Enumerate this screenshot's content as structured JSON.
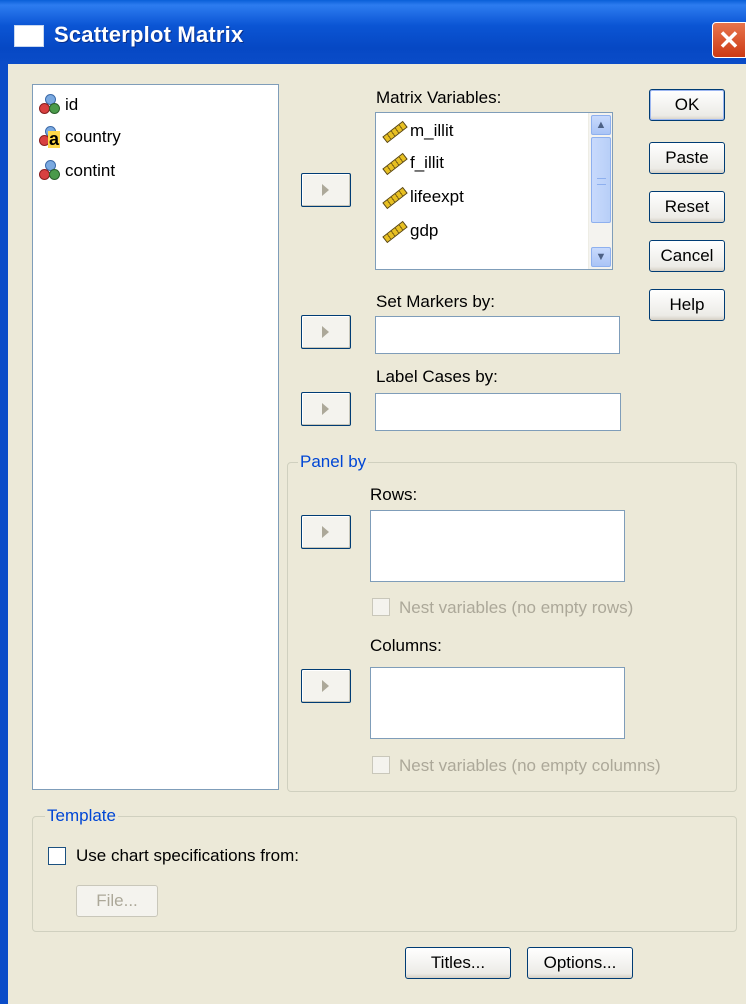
{
  "window": {
    "title": "Scatterplot Matrix",
    "close_glyph": "✕"
  },
  "variables": [
    {
      "name": "id",
      "icon": "nominal-icon"
    },
    {
      "name": "country",
      "icon": "string-nominal-icon",
      "letter": "a"
    },
    {
      "name": "contint",
      "icon": "nominal-icon"
    }
  ],
  "matrix": {
    "label": "Matrix Variables:",
    "items": [
      "m_illit",
      "f_illit",
      "lifeexpt",
      "gdp"
    ]
  },
  "markers": {
    "label": "Set Markers by:",
    "value": ""
  },
  "label_cases": {
    "label": "Label Cases by:",
    "value": ""
  },
  "panel": {
    "title": "Panel by",
    "rows_label": "Rows:",
    "nest_rows_label": "Nest variables (no empty rows)",
    "columns_label": "Columns:",
    "nest_columns_label": "Nest variables (no empty columns)"
  },
  "template": {
    "title": "Template",
    "use_spec_label": "Use chart specifications from:",
    "file_button": "File..."
  },
  "buttons": {
    "ok": "OK",
    "paste": "Paste",
    "reset": "Reset",
    "cancel": "Cancel",
    "help": "Help",
    "titles": "Titles...",
    "options": "Options..."
  },
  "colors": {
    "titlebar": "#0a4cc8",
    "dialog_bg": "#ece9d8",
    "group_title": "#0046d5",
    "close_button": "#cc3a15"
  }
}
